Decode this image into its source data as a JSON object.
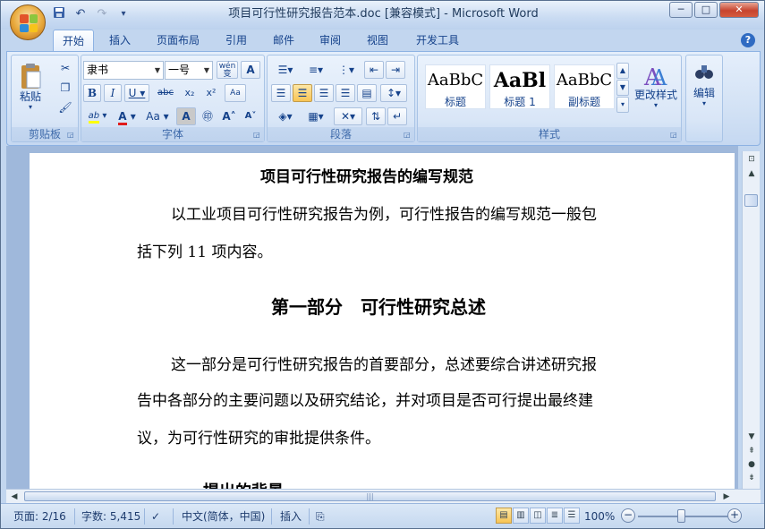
{
  "window": {
    "title": "项目可行性研究报告范本.doc [兼容模式] - Microsoft Word",
    "minimize": "─",
    "maximize": "□",
    "close": "✕"
  },
  "qat": {
    "save_icon": "save-icon",
    "undo": "↶",
    "redo": "↷",
    "more": "▾"
  },
  "tabs": [
    "开始",
    "插入",
    "页面布局",
    "引用",
    "邮件",
    "审阅",
    "视图",
    "开发工具"
  ],
  "help": "?",
  "ribbon": {
    "clipboard": {
      "label": "剪贴板",
      "paste": "粘贴"
    },
    "font": {
      "label": "字体",
      "font_name": "隶书",
      "font_size": "一号",
      "wen": "wén",
      "bold": "B",
      "italic": "I",
      "underline": "U",
      "strike": "abc",
      "sub": "x₂",
      "sup": "x²",
      "clear": "Aa",
      "grow": "A",
      "shrink": "A",
      "font_color": "A",
      "case": "Aa",
      "highlight": "ab"
    },
    "paragraph": {
      "label": "段落"
    },
    "styles": {
      "label": "样式",
      "tiles": [
        {
          "sample": "AaBbC",
          "name": "标题"
        },
        {
          "sample": "AaBl",
          "name": "标题 1"
        },
        {
          "sample": "AaBbC",
          "name": "副标题"
        }
      ],
      "change_styles": "更改样式"
    },
    "editing": {
      "label": "编辑"
    }
  },
  "document": {
    "title": "项目可行性研究报告的编写规范",
    "intro_line1": "以工业项目可行性研究报告为例，可行性报告的编写规范一般包",
    "intro_line2": "括下列 11 项内容。",
    "section_heading": "第一部分　可行性研究总述",
    "para_line1": "这一部分是可行性研究报告的首要部分，总述要综合讲述研究报",
    "para_line2": "告中各部分的主要问题以及研究结论，并对项目是否可行提出最终建",
    "para_line3": "议，为可行性研究的审批提供条件。",
    "partial_heading": "一、提出的背景"
  },
  "statusbar": {
    "page": "页面: 2/16",
    "words": "字数: 5,415",
    "language": "中文(简体，中国)",
    "mode": "插入",
    "zoom": "100%",
    "zoom_out": "−",
    "zoom_in": "+"
  },
  "colors": {
    "ribbon_bg": "#dbe7f6",
    "accent": "#15428b",
    "highlight": "#f8c454"
  }
}
